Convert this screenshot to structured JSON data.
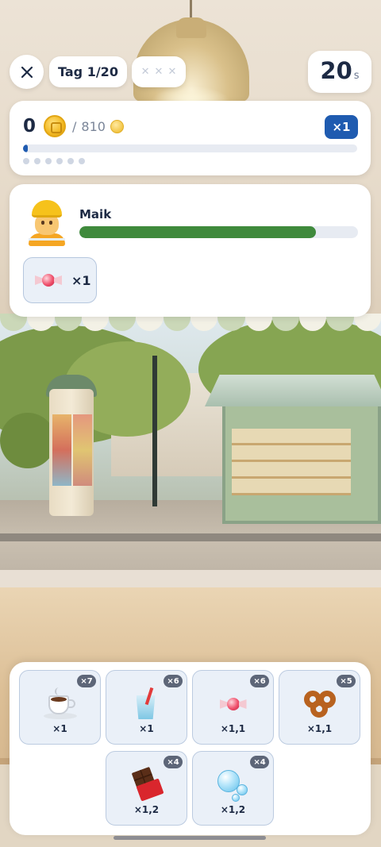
{
  "topbar": {
    "close_icon": "close-icon",
    "day_label": "Tag 1/20",
    "stars": {
      "earned": 0,
      "total": 3,
      "empty_color": "#c4cbd8"
    },
    "timer_value": "20",
    "timer_unit": "s"
  },
  "coins": {
    "current": "0",
    "separator": "/",
    "goal": "810",
    "multiplier": "×1",
    "progress_fraction": 0.01,
    "milestone_count": 6,
    "accent_color": "#1f5bb0"
  },
  "customer": {
    "avatar_icon": "construction-worker-icon",
    "name": "Maik",
    "patience_fraction": 0.85,
    "patience_color": "#3f8a3c",
    "order": [
      {
        "icon": "candy-icon",
        "quantity": "×1"
      }
    ]
  },
  "inventory": [
    {
      "icon": "coffee-icon",
      "stock": "×7",
      "price": "×1"
    },
    {
      "icon": "cup-with-straw-icon",
      "stock": "×6",
      "price": "×1"
    },
    {
      "icon": "candy-icon",
      "stock": "×6",
      "price": "×1,1"
    },
    {
      "icon": "pretzel-icon",
      "stock": "×5",
      "price": "×1,1"
    },
    {
      "icon": "chocolate-bar-icon",
      "stock": "×4",
      "price": "×1,2"
    },
    {
      "icon": "bubbles-icon",
      "stock": "×4",
      "price": "×1,2"
    }
  ]
}
